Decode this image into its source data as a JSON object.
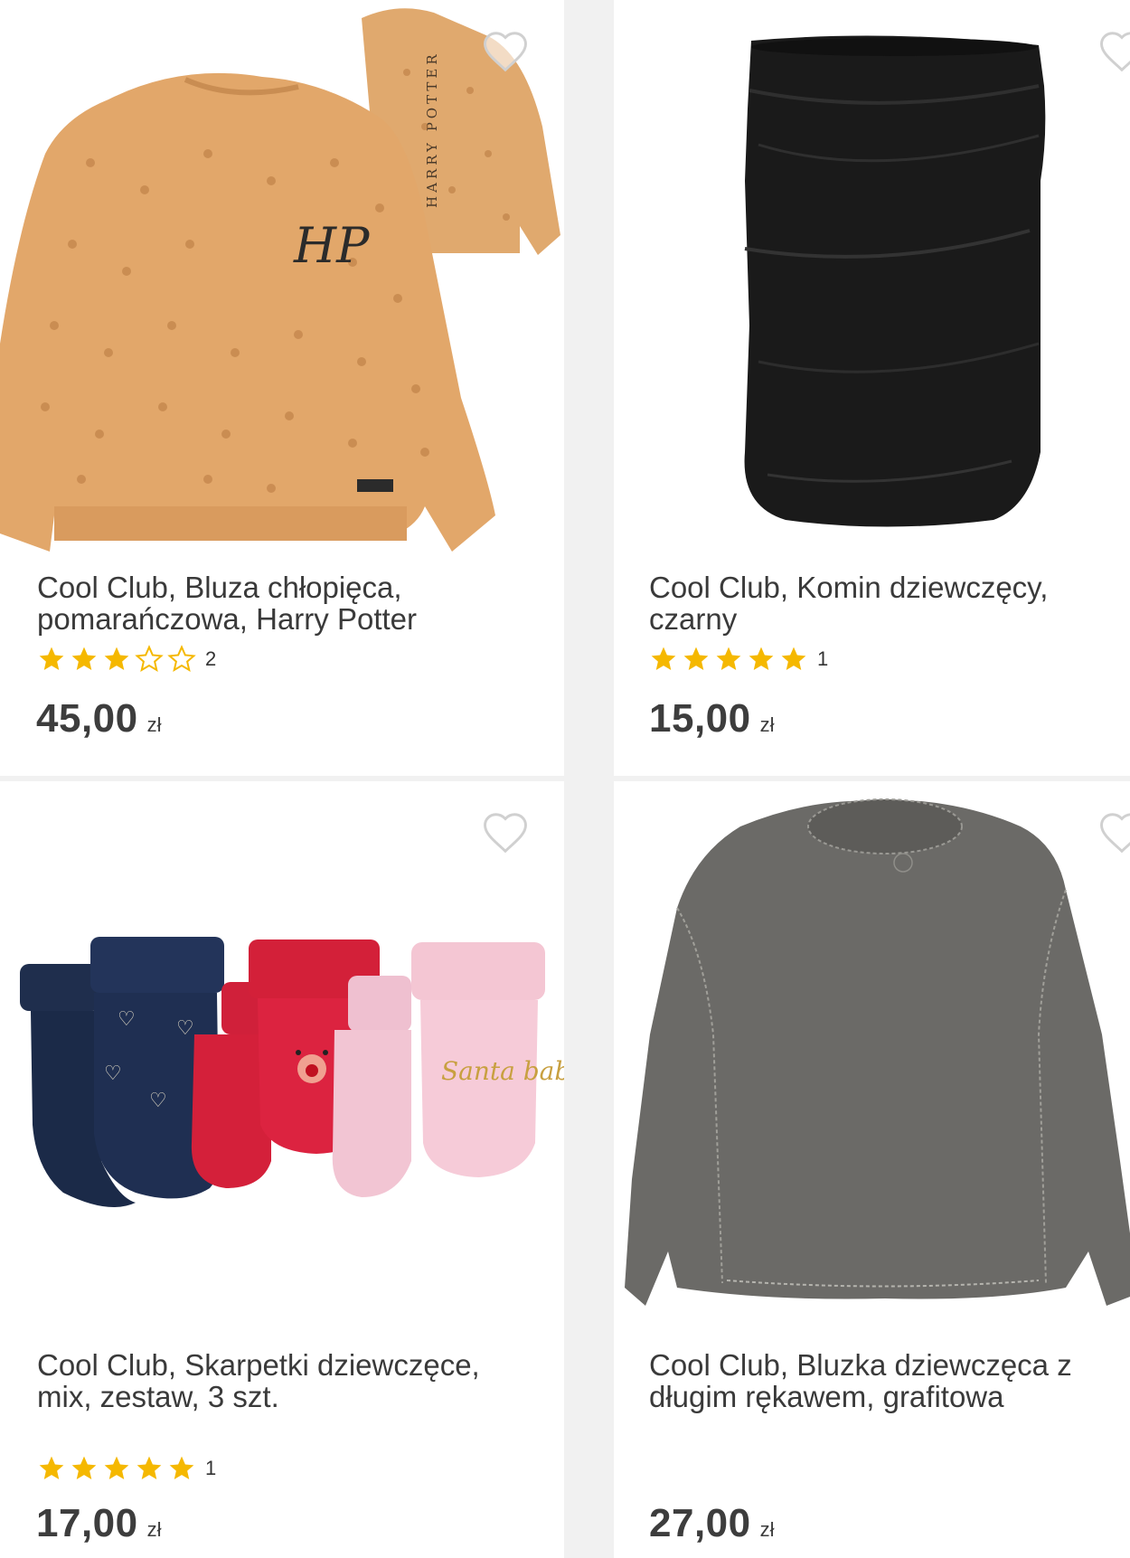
{
  "products": [
    {
      "title_line1": "Cool Club, Bluza chłopięca,",
      "title_line2": "pomarańczowa, Harry Potter",
      "rating": 3,
      "rating_count": "2",
      "price": "45,00",
      "currency": "zł",
      "image_icon": "orange-sweatshirt-image",
      "print_text": "HARRY POTTER",
      "logo_text": "HP",
      "favorite": false
    },
    {
      "title_line1": "Cool Club, Komin dziewczęcy,",
      "title_line2": "czarny",
      "rating": 5,
      "rating_count": "1",
      "price": "15,00",
      "currency": "zł",
      "image_icon": "black-snood-image",
      "favorite": false
    },
    {
      "title_line1": "Cool Club, Skarpetki dziewczęce,",
      "title_line2": "mix, zestaw, 3 szt.",
      "rating": 5,
      "rating_count": "1",
      "price": "17,00",
      "currency": "zł",
      "image_icon": "socks-set-image",
      "print_text": "Santa baby",
      "favorite": false
    },
    {
      "title_line1": "Cool Club, Bluzka dziewczęca z",
      "title_line2": "długim rękawem, grafitowa",
      "rating": 0,
      "rating_count": "",
      "price": "27,00",
      "currency": "zł",
      "image_icon": "grey-longsleeve-image",
      "favorite": false
    }
  ],
  "colors": {
    "star_filled": "#f5b800",
    "star_empty": "#f5b800",
    "heart_outline": "#d0d0d0",
    "price_text": "#3d3d3d"
  }
}
